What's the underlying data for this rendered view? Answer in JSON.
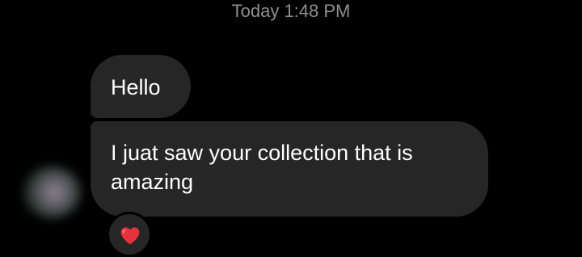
{
  "thread": {
    "timestamp": "Today 1:48 PM",
    "messages": [
      {
        "text": "Hello"
      },
      {
        "text": "I juat saw your collection that is amazing"
      }
    ],
    "reaction": {
      "icon": "heart-icon",
      "color": "#e8313f"
    }
  },
  "colors": {
    "background": "#000000",
    "bubble": "#262626",
    "text": "#ffffff",
    "timestamp": "#8e8e8e"
  }
}
